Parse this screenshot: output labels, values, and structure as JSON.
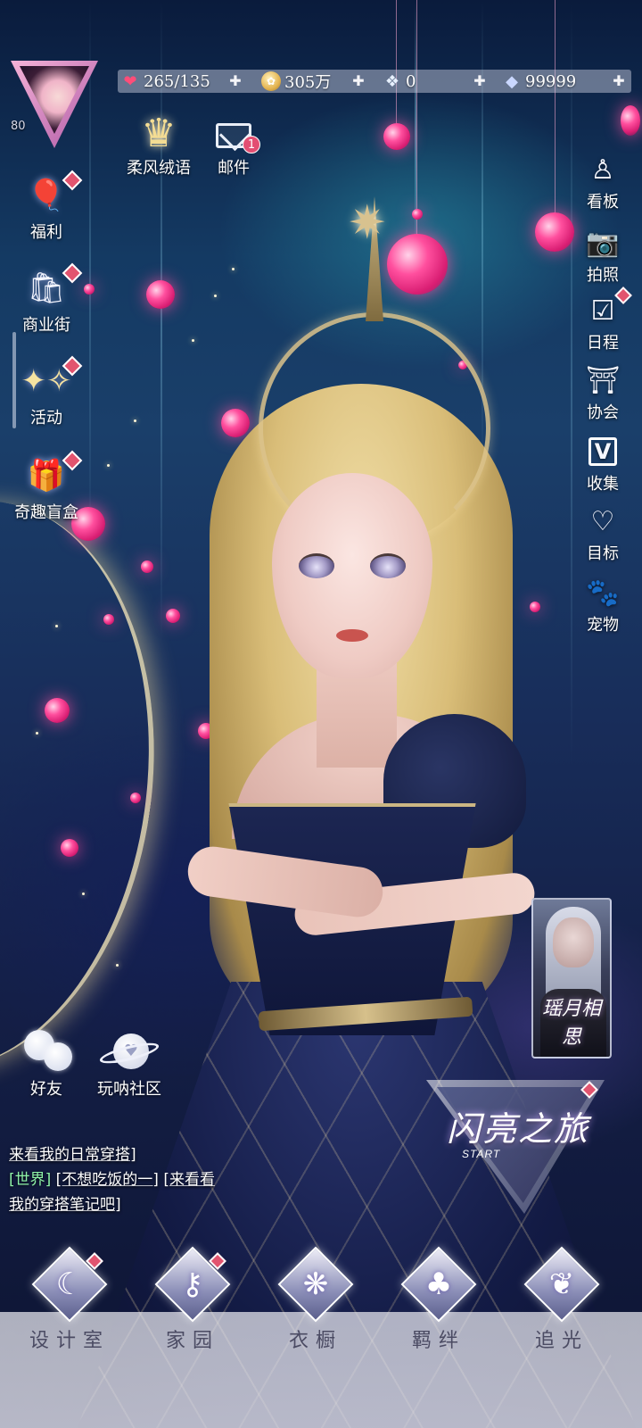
{
  "profile": {
    "level": "80"
  },
  "resources": [
    {
      "icon": "heart-icon",
      "value": "265/135"
    },
    {
      "icon": "coin-icon",
      "value": "305万"
    },
    {
      "icon": "crystal-icon",
      "value": "0"
    },
    {
      "icon": "diamond-icon",
      "value": "99999"
    }
  ],
  "top_features": {
    "rank_label": "柔风绒语",
    "mail_label": "邮件",
    "mail_badge": "1"
  },
  "left_menu": [
    {
      "label": "福利",
      "icon": "hot-air-balloon-icon"
    },
    {
      "label": "商业街",
      "icon": "shopping-bag-icon"
    },
    {
      "label": "活动",
      "icon": "stars-icon"
    },
    {
      "label": "奇趣盲盒",
      "icon": "gift-box-icon"
    }
  ],
  "right_menu": [
    {
      "label": "看板",
      "icon": "dress-icon"
    },
    {
      "label": "拍照",
      "icon": "camera-icon"
    },
    {
      "label": "日程",
      "icon": "calendar-icon"
    },
    {
      "label": "协会",
      "icon": "guild-icon"
    },
    {
      "label": "收集",
      "icon": "collection-icon"
    },
    {
      "label": "目标",
      "icon": "target-medal-icon"
    },
    {
      "label": "宠物",
      "icon": "paw-icon"
    }
  ],
  "portrait_card": {
    "title": "瑶月相思"
  },
  "social": {
    "friends_label": "好友",
    "community_label": "玩呐社区"
  },
  "chat": {
    "line1": "来看我的日常穿搭]",
    "channel": "[世界]",
    "sender": "[不想吃饭的一]",
    "line2_msg": "[来看看",
    "line3": "我的穿搭笔记吧]"
  },
  "start_journey": {
    "title": "闪亮之旅",
    "subtitle": "START"
  },
  "bottom_nav": [
    {
      "label": "设计室",
      "icon": "moon-icon"
    },
    {
      "label": "家园",
      "icon": "key-icon"
    },
    {
      "label": "衣橱",
      "icon": "crystal-flower-icon"
    },
    {
      "label": "羁绊",
      "icon": "clover-icon"
    },
    {
      "label": "追光",
      "icon": "butterfly-icon"
    }
  ],
  "colors": {
    "badge_red": "#e34e72",
    "world_channel": "#8ef2a7",
    "orb_pink": "#ff4f9e"
  }
}
